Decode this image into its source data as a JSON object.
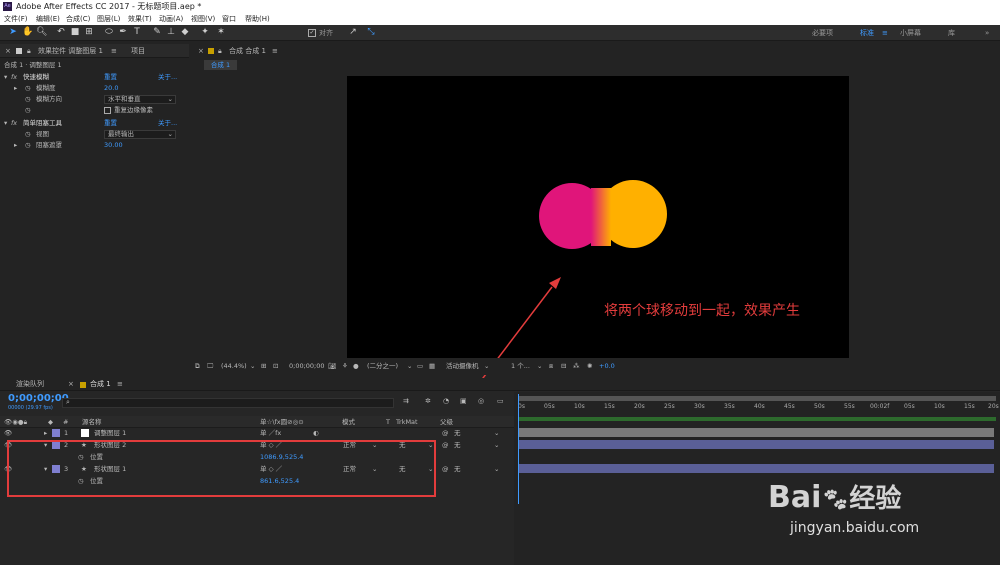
{
  "app": {
    "title": "Adobe After Effects CC 2017 - 无标题项目.aep *",
    "logo_text": "Ae"
  },
  "menu": [
    "文件(F)",
    "编辑(E)",
    "合成(C)",
    "图层(L)",
    "效果(T)",
    "动画(A)",
    "视图(V)",
    "窗口",
    "帮助(H)"
  ],
  "toolbar": {
    "align_label": "对齐",
    "workspaces": [
      "必要项",
      "标准",
      "小屏幕",
      "库"
    ]
  },
  "effects_panel": {
    "tab_effects": "效果控件 调整图层 1",
    "tab_project": "项目",
    "path": "合成 1 · 调整图层 1",
    "effects": [
      {
        "name": "快速模糊",
        "reset": "重置",
        "about": "关于...",
        "props": [
          {
            "label": "模糊度",
            "value": "20.0"
          },
          {
            "label": "模糊方向",
            "value": "水平和垂直"
          },
          {
            "label": "重复边缘像素",
            "value": ""
          }
        ]
      },
      {
        "name": "简单阻塞工具",
        "reset": "重置",
        "about": "关于...",
        "props": [
          {
            "label": "视图",
            "value": "最终输出"
          },
          {
            "label": "阻塞遮罩",
            "value": "30.00"
          }
        ]
      }
    ]
  },
  "viewer": {
    "tab": "合成 合成 1",
    "comp_label": "合成 1",
    "zoom": "(44.4%)",
    "timecode": "0;00;00;00",
    "resolution": "(二分之一)",
    "camera": "活动摄像机",
    "views": "1 个...",
    "exposure": "+0.0"
  },
  "annotation": {
    "text": "将两个球移动到一起，效果产生",
    "color": "#e23c3c"
  },
  "balls": [
    {
      "color": "#e0157a",
      "name": "magenta-ball"
    },
    {
      "color": "#ffb000",
      "name": "orange-ball"
    }
  ],
  "timeline": {
    "tab_render": "渲染队列",
    "tab_comp": "合成 1",
    "timecode": "0;00;00;00",
    "fps": "00000 (29.97 fps)",
    "search_placeholder": "",
    "headers": {
      "num": "#",
      "name": "源名称",
      "switches": "单☆\\fx圆⊘◎⊙",
      "mode": "模式",
      "t": "T",
      "trkmat": "TrkMat",
      "parent": "父级"
    },
    "layers": [
      {
        "num": "1",
        "name": "调整图层 1",
        "mode": "",
        "trkmat": "",
        "parent": "无"
      },
      {
        "num": "2",
        "name": "形状图层 2",
        "mode": "正常",
        "trkmat": "无",
        "parent": "无",
        "prop": "位置",
        "value": "1086.9,525.4"
      },
      {
        "num": "3",
        "name": "形状图层 1",
        "mode": "正常",
        "trkmat": "无",
        "parent": "无",
        "prop": "位置",
        "value": "861.6,525.4"
      }
    ],
    "ruler": [
      "0s",
      "05s",
      "10s",
      "15s",
      "20s",
      "25s",
      "30s",
      "35s",
      "40s",
      "45s",
      "50s",
      "55s",
      "00:02f",
      "05s",
      "10s",
      "15s",
      "20s",
      "2"
    ]
  },
  "watermark": {
    "brand": "Bai",
    "paw": "du",
    "cn": "经验",
    "url": "jingyan.baidu.com"
  }
}
